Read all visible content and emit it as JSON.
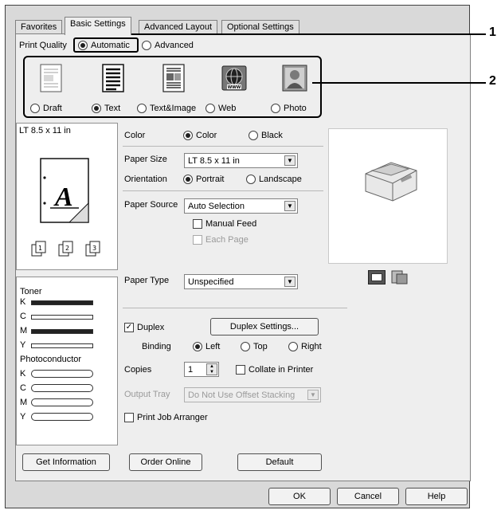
{
  "tabs": [
    "Favorites",
    "Basic Settings",
    "Advanced Layout",
    "Optional Settings"
  ],
  "print_quality": {
    "label": "Print Quality",
    "automatic": "Automatic",
    "advanced": "Advanced",
    "selected": "Automatic"
  },
  "quality_modes": [
    {
      "label": "Draft",
      "icon": "draft-document-icon",
      "selected": false
    },
    {
      "label": "Text",
      "icon": "text-document-icon",
      "selected": true
    },
    {
      "label": "Text&Image",
      "icon": "text-image-document-icon",
      "selected": false
    },
    {
      "label": "Web",
      "icon": "web-globe-icon",
      "selected": false
    },
    {
      "label": "Photo",
      "icon": "photo-portrait-icon",
      "selected": false
    }
  ],
  "preview": {
    "paper_size": "LT 8.5 x 11 in",
    "letter": "A"
  },
  "color": {
    "label": "Color",
    "color_option": "Color",
    "black_option": "Black",
    "selected": "Color"
  },
  "paper_size": {
    "label": "Paper Size",
    "value": "LT 8.5 x 11 in"
  },
  "orientation": {
    "label": "Orientation",
    "portrait": "Portrait",
    "landscape": "Landscape",
    "selected": "Portrait"
  },
  "paper_source": {
    "label": "Paper Source",
    "value": "Auto Selection",
    "manual_feed": "Manual Feed",
    "each_page": "Each Page"
  },
  "paper_type": {
    "label": "Paper Type",
    "value": "Unspecified"
  },
  "duplex": {
    "label": "Duplex",
    "checked": true,
    "settings_button": "Duplex Settings..."
  },
  "binding": {
    "label": "Binding",
    "left": "Left",
    "top": "Top",
    "right": "Right",
    "selected": "Left"
  },
  "copies": {
    "label": "Copies",
    "value": "1",
    "collate": "Collate in Printer"
  },
  "output_tray": {
    "label": "Output Tray",
    "value": "Do Not Use Offset Stacking"
  },
  "print_job_arranger": "Print Job Arranger",
  "toner": {
    "label": "Toner",
    "levels": [
      {
        "name": "K",
        "level": 1.0
      },
      {
        "name": "C",
        "level": 0.0
      },
      {
        "name": "M",
        "level": 1.0
      },
      {
        "name": "Y",
        "level": 0.0
      }
    ]
  },
  "photoconductor": {
    "label": "Photoconductor",
    "units": [
      "K",
      "C",
      "M",
      "Y"
    ]
  },
  "buttons": {
    "get_information": "Get Information",
    "order_online": "Order Online",
    "default": "Default",
    "ok": "OK",
    "cancel": "Cancel",
    "help": "Help"
  },
  "callouts": [
    "1",
    "2"
  ]
}
